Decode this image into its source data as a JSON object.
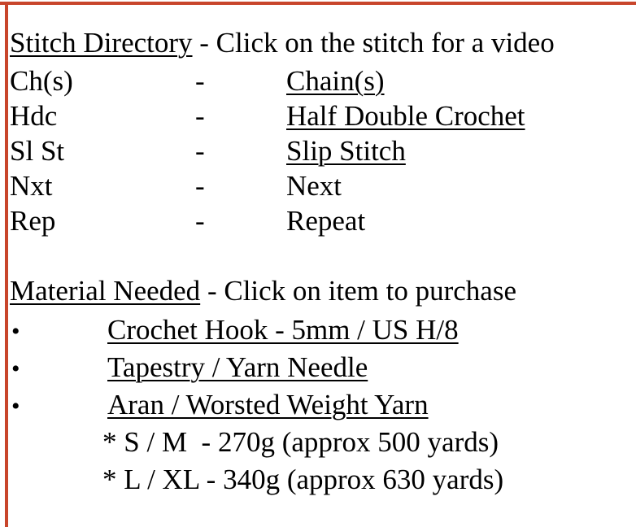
{
  "colors": {
    "accent": "#C8452B",
    "background": "#FFFFFF",
    "text": "#000000"
  },
  "stitch_directory": {
    "heading": "Stitch Directory",
    "heading_note": " - Click on the stitch for a video",
    "separator": "-",
    "rows": [
      {
        "abbr": "Ch(s)",
        "definition": "Chain(s)",
        "is_link": true
      },
      {
        "abbr": "Hdc",
        "definition": "Half Double Crochet",
        "is_link": true
      },
      {
        "abbr": "Sl St",
        "definition": "Slip Stitch",
        "is_link": true
      },
      {
        "abbr": "Nxt",
        "definition": "Next",
        "is_link": false
      },
      {
        "abbr": "Rep",
        "definition": "Repeat",
        "is_link": false
      }
    ]
  },
  "material_needed": {
    "heading": "Material Needed",
    "heading_note": " - Click on item to purchase",
    "bullet_glyph": "•",
    "items": [
      {
        "label": "Crochet Hook - 5mm / US H/8",
        "is_link": true
      },
      {
        "label": "Tapestry / Yarn Needle",
        "is_link": true
      },
      {
        "label": "Aran / Worsted Weight Yarn",
        "is_link": true
      }
    ],
    "notes": [
      "* S / M  - 270g (approx 500 yards)",
      "* L / XL - 340g (approx 630 yards)"
    ]
  }
}
